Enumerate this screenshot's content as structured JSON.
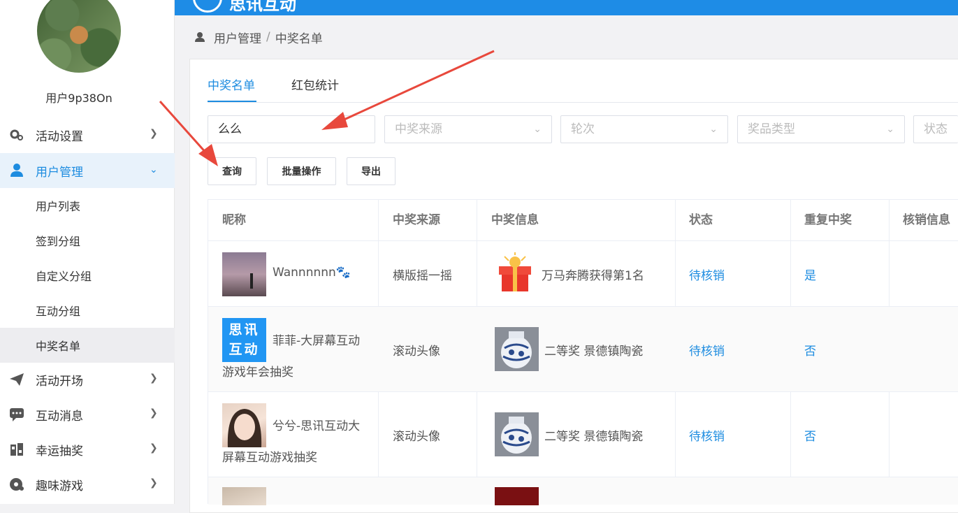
{
  "header": {
    "logo_text": "思讯互动"
  },
  "user": {
    "name": "用户9p38On"
  },
  "sidebar": {
    "items": [
      {
        "label": "活动设置",
        "icon": "gear-icon"
      },
      {
        "label": "用户管理",
        "icon": "user-icon"
      },
      {
        "label": "活动开场",
        "icon": "paper-plane-icon"
      },
      {
        "label": "互动消息",
        "icon": "chat-icon"
      },
      {
        "label": "幸运抽奖",
        "icon": "lottery-icon"
      },
      {
        "label": "趣味游戏",
        "icon": "gamepad-icon"
      }
    ],
    "sub_items": [
      "用户列表",
      "签到分组",
      "自定义分组",
      "互动分组",
      "中奖名单"
    ]
  },
  "breadcrumb": {
    "root": "用户管理",
    "sep": "/",
    "current": "中奖名单"
  },
  "tabs": [
    "中奖名单",
    "红包统计"
  ],
  "filters": {
    "search_value": "么么",
    "source_placeholder": "中奖来源",
    "round_placeholder": "轮次",
    "prize_type_placeholder": "奖品类型",
    "status_placeholder": "状态"
  },
  "buttons": {
    "query": "查询",
    "batch": "批量操作",
    "export": "导出"
  },
  "table": {
    "headers": [
      "昵称",
      "中奖来源",
      "中奖信息",
      "状态",
      "重复中奖",
      "核销信息"
    ],
    "rows": [
      {
        "nickname": "Wannnnnn🐾",
        "source": "横版摇一摇",
        "prize": "万马奔腾获得第1名",
        "status": "待核销",
        "repeat": "是"
      },
      {
        "nickname_line1": "菲菲-大屏幕互动",
        "nickname_line2": "游戏年会抽奖",
        "avatar_text": "思讯互动",
        "source": "滚动头像",
        "prize": "二等奖 景德镇陶瓷",
        "status": "待核销",
        "repeat": "否"
      },
      {
        "nickname_line1": "兮兮-思讯互动大",
        "nickname_line2": "屏幕互动游戏抽奖",
        "source": "滚动头像",
        "prize": "二等奖 景德镇陶瓷",
        "status": "待核销",
        "repeat": "否"
      }
    ]
  }
}
